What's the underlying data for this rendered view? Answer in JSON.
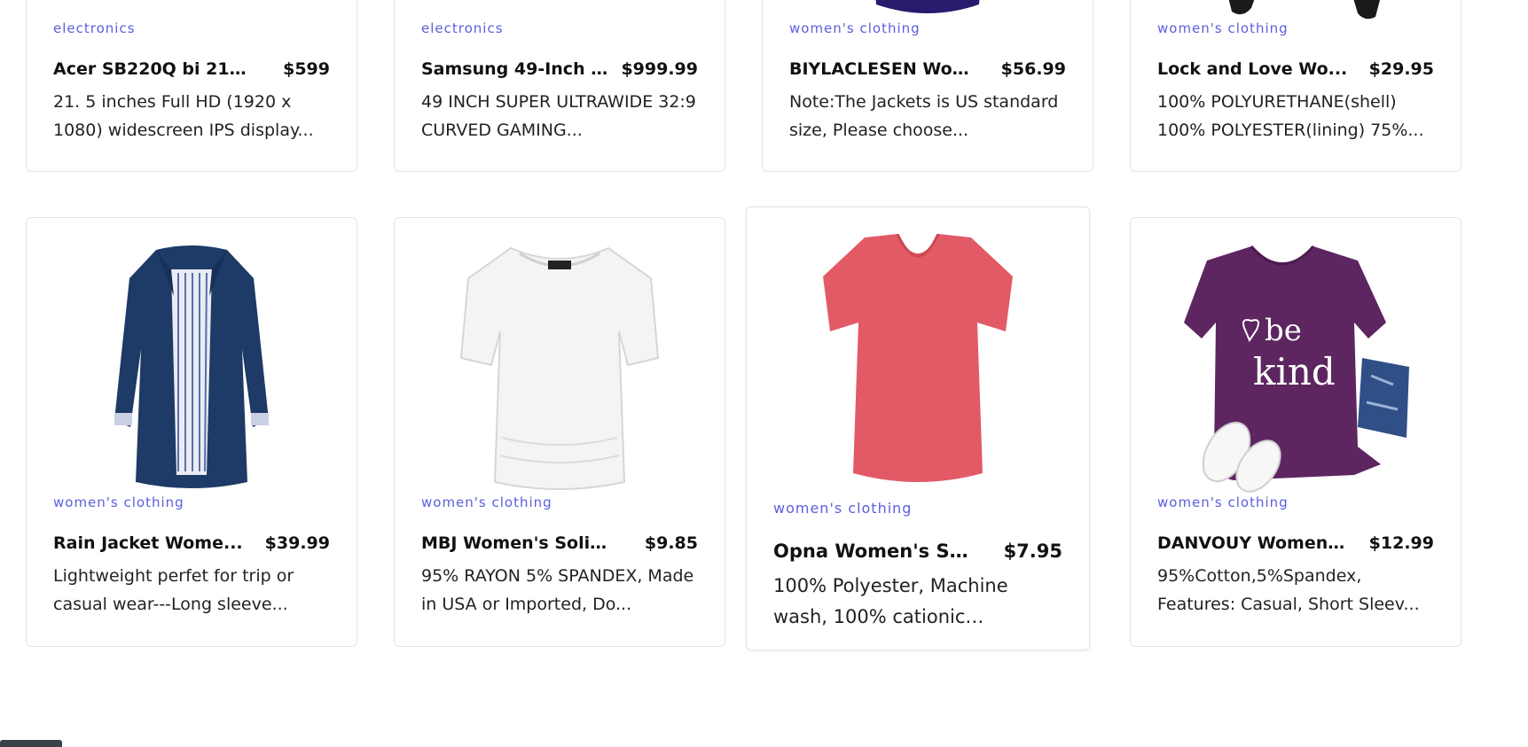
{
  "products_top": [
    {
      "category": "electronics",
      "title": "Acer SB220Q bi 21.5...",
      "price": "$599",
      "description": "21. 5 inches Full HD (1920 x 1080) widescreen IPS display..."
    },
    {
      "category": "electronics",
      "title": "Samsung 49-Inch C...",
      "price": "$999.99",
      "description": "49 INCH SUPER ULTRAWIDE 32:9 CURVED GAMING..."
    },
    {
      "category": "women's clothing",
      "title": "BIYLACLESEN Wom...",
      "price": "$56.99",
      "description": "Note:The Jackets is US standard size, Please choose..."
    },
    {
      "category": "women's clothing",
      "title": "Lock and Love Wo...",
      "price": "$29.95",
      "description": "100% POLYURETHANE(shell) 100% POLYESTER(lining) 75%..."
    }
  ],
  "products_bottom": [
    {
      "category": "women's clothing",
      "title": "Rain Jacket Wome...",
      "price": "$39.99",
      "description": "Lightweight perfet for trip or casual wear---Long sleeve...",
      "image_icon": "navy-rain-jacket-image"
    },
    {
      "category": "women's clothing",
      "title": "MBJ Women's Solid...",
      "price": "$9.85",
      "description": "95% RAYON 5% SPANDEX, Made in USA or Imported, Do...",
      "image_icon": "white-tshirt-image"
    },
    {
      "category": "women's clothing",
      "title": "Opna Women's Sho...",
      "price": "$7.95",
      "description": "100% Polyester, Machine wash, 100% cationic polyester...",
      "image_icon": "pink-vneck-tshirt-image"
    },
    {
      "category": "women's clothing",
      "title": "DANVOUY Womens...",
      "price": "$12.99",
      "description": "95%Cotton,5%Spandex, Features: Casual, Short Sleev...",
      "image_icon": "purple-be-kind-tshirt-image"
    }
  ],
  "image_text": {
    "shirt_print": "be kind"
  },
  "colors": {
    "accent": "#5b5fdc",
    "border": "#e4e4e4"
  }
}
